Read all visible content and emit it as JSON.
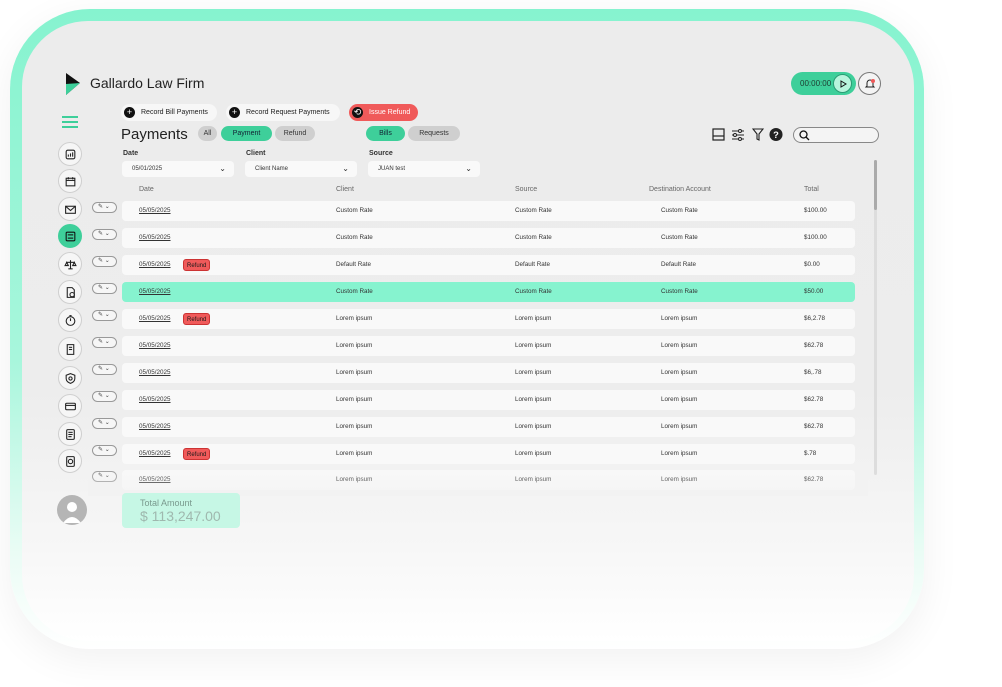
{
  "app": {
    "title": "Gallardo Law Firm"
  },
  "header": {
    "timer": "00:00:00"
  },
  "actions": {
    "record_bill": "Record Bill Payments",
    "record_request": "Record Request Payments",
    "issue_refund": "Issue Refund"
  },
  "page": {
    "title": "Payments",
    "type_tabs": [
      "All",
      "Payment",
      "Refund"
    ],
    "type_selected": "Payment",
    "source_tabs": [
      "Bills",
      "Requests"
    ],
    "source_selected": "Bills"
  },
  "filters": {
    "date_label": "Date",
    "date_value": "05/01/2025",
    "client_label": "Client",
    "client_value": "Client Name",
    "source_label": "Source",
    "source_value": "JUAN test"
  },
  "table": {
    "headers": [
      "Date",
      "Client",
      "Source",
      "Destination Account",
      "Total"
    ],
    "refund_badge": "Refund",
    "rows": [
      {
        "date": "05/05/2025",
        "client": "Custom Rate",
        "source": "Custom Rate",
        "destination": "Custom Rate",
        "total": "$100.00",
        "refund": false,
        "selected": false
      },
      {
        "date": "05/05/2025",
        "client": "Custom Rate",
        "source": "Custom Rate",
        "destination": "Custom Rate",
        "total": "$100.00",
        "refund": false,
        "selected": false
      },
      {
        "date": "05/05/2025",
        "client": "Default Rate",
        "source": "Default Rate",
        "destination": "Default Rate",
        "total": "$0.00",
        "refund": true,
        "selected": false
      },
      {
        "date": "05/05/2025",
        "client": "Custom Rate",
        "source": "Custom Rate",
        "destination": "Custom Rate",
        "total": "$50.00",
        "refund": false,
        "selected": true
      },
      {
        "date": "05/05/2025",
        "client": "Lorem ipsum",
        "source": "Lorem ipsum",
        "destination": "Lorem ipsum",
        "total": "$6,2.78",
        "refund": true,
        "selected": false
      },
      {
        "date": "05/05/2025",
        "client": "Lorem ipsum",
        "source": "Lorem ipsum",
        "destination": "Lorem ipsum",
        "total": "$62.78",
        "refund": false,
        "selected": false
      },
      {
        "date": "05/05/2025",
        "client": "Lorem ipsum",
        "source": "Lorem ipsum",
        "destination": "Lorem ipsum",
        "total": "$6,.78",
        "refund": false,
        "selected": false
      },
      {
        "date": "05/05/2025",
        "client": "Lorem ipsum",
        "source": "Lorem ipsum",
        "destination": "Lorem ipsum",
        "total": "$62.78",
        "refund": false,
        "selected": false
      },
      {
        "date": "05/05/2025",
        "client": "Lorem ipsum",
        "source": "Lorem ipsum",
        "destination": "Lorem ipsum",
        "total": "$62.78",
        "refund": false,
        "selected": false
      },
      {
        "date": "05/05/2025",
        "client": "Lorem ipsum",
        "source": "Lorem ipsum",
        "destination": "Lorem ipsum",
        "total": "$.78",
        "refund": true,
        "selected": false
      },
      {
        "date": "05/05/2025",
        "client": "Lorem ipsum",
        "source": "Lorem ipsum",
        "destination": "Lorem ipsum",
        "total": "$62.78",
        "refund": false,
        "selected": false
      }
    ]
  },
  "summary": {
    "total_label": "Total Amount",
    "total_value": "$ 113,247.00"
  },
  "sidebar": {
    "items": [
      "dashboard-icon",
      "calendar-icon",
      "mail-icon",
      "payments-icon",
      "scale-icon",
      "document-icon",
      "timer-icon",
      "contract-icon",
      "shield-icon",
      "card-icon",
      "invoice-icon",
      "report-icon"
    ],
    "active": "payments-icon"
  },
  "colors": {
    "accent": "#3ecf9a",
    "selected_row": "#86f3cf",
    "refund": "#f05a5a",
    "frame": "#86f3cf"
  }
}
